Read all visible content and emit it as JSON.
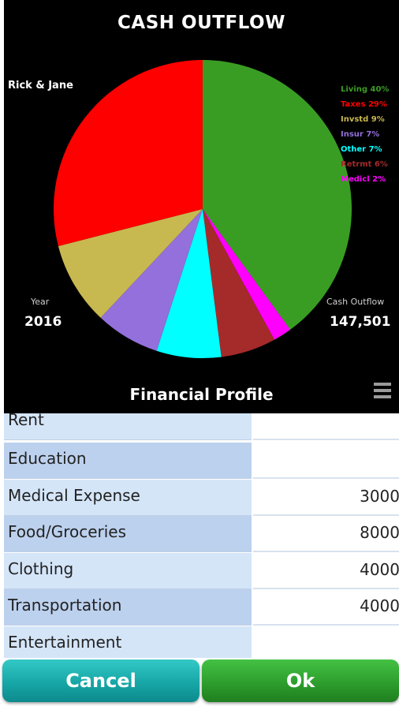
{
  "chart_panel": {
    "title": "CASH OUTFLOW",
    "owner": "Rick & Jane",
    "year_label": "Year",
    "year_value": "2016",
    "outflow_label": "Cash Outflow",
    "outflow_value": "147,501",
    "footer_title": "Financial Profile",
    "menu_icon": "hamburger-menu-icon"
  },
  "chart_data": {
    "type": "pie",
    "title": "CASH OUTFLOW",
    "slices": [
      {
        "label": "Living",
        "percent": 40,
        "legend_text": "Living 40%",
        "color": "#3a9d23"
      },
      {
        "label": "Medicl",
        "percent": 2,
        "legend_text": "Medicl 2%",
        "color": "#ff00ff"
      },
      {
        "label": "Retrmt",
        "percent": 6,
        "legend_text": "Retrmt 6%",
        "color": "#a52a2a"
      },
      {
        "label": "Other",
        "percent": 7,
        "legend_text": "Other 7%",
        "color": "#00ffff"
      },
      {
        "label": "Insur",
        "percent": 7,
        "legend_text": "Insur 7%",
        "color": "#9370db"
      },
      {
        "label": "Invstd",
        "percent": 9,
        "legend_text": "Invstd 9%",
        "color": "#c8b850"
      },
      {
        "label": "Taxes",
        "percent": 29,
        "legend_text": "Taxes 29%",
        "color": "#ff0000"
      }
    ],
    "legend_order": [
      "Living 40%",
      "Taxes 29%",
      "Invstd 9%",
      "Insur 7%",
      "Other 7%",
      "Retrmt 6%",
      "Medicl 2%"
    ],
    "legend_colors": [
      "#3a9d23",
      "#ff0000",
      "#c8b850",
      "#9370db",
      "#00ffff",
      "#a52a2a",
      "#ff00ff"
    ],
    "legend_position": "right"
  },
  "table": {
    "rows": [
      {
        "label": "Rent",
        "value": ""
      },
      {
        "label": "Education",
        "value": ""
      },
      {
        "label": "Medical Expense",
        "value": "3000"
      },
      {
        "label": "Food/Groceries",
        "value": "8000"
      },
      {
        "label": "Clothing",
        "value": "4000"
      },
      {
        "label": "Transportation",
        "value": "4000"
      },
      {
        "label": "Entertainment",
        "value": ""
      }
    ]
  },
  "buttons": {
    "cancel_label": "Cancel",
    "ok_label": "Ok"
  }
}
